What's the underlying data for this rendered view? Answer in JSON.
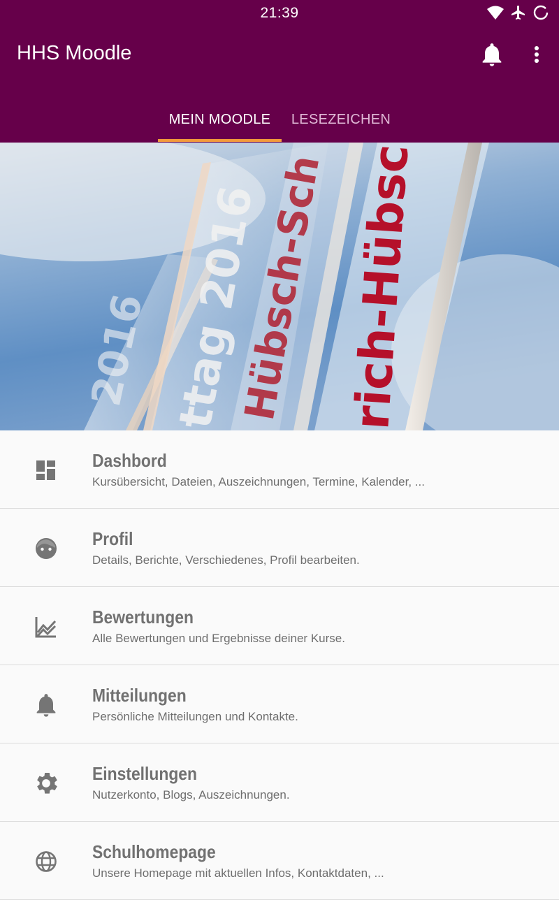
{
  "status_bar": {
    "time": "21:39",
    "icons": [
      "wifi-icon",
      "airplane-mode-icon",
      "battery-charging-icon"
    ]
  },
  "app_bar": {
    "title": "HHS Moodle",
    "actions": [
      "notifications-bell-icon",
      "more-vert-icon"
    ]
  },
  "tabs": [
    {
      "label": "MEIN MOODLE",
      "active": true
    },
    {
      "label": "LESEZEICHEN",
      "active": false
    }
  ],
  "hero": {
    "texts": [
      "2016",
      "ttag 2016",
      "Hübsch-Sch",
      "rich-Hübsc"
    ]
  },
  "menu": [
    {
      "icon": "dashboard-icon",
      "title": "Dashbord",
      "subtitle": "Kursübersicht, Dateien, Auszeichnungen, Termine, Kalender, ..."
    },
    {
      "icon": "profile-face-icon",
      "title": "Profil",
      "subtitle": "Details, Berichte, Verschiedenes, Profil bearbeiten."
    },
    {
      "icon": "chart-icon",
      "title": "Bewertungen",
      "subtitle": "Alle Bewertungen und Ergebnisse deiner Kurse."
    },
    {
      "icon": "bell-icon",
      "title": "Mitteilungen",
      "subtitle": "Persönliche Mitteilungen und Kontakte."
    },
    {
      "icon": "gear-icon",
      "title": "Einstellungen",
      "subtitle": "Nutzerkonto, Blogs, Auszeichnungen."
    },
    {
      "icon": "globe-icon",
      "title": "Schulhomepage",
      "subtitle": "Unsere Homepage mit aktuellen Infos, Kontaktdaten, ..."
    }
  ],
  "colors": {
    "primary": "#66004a",
    "accent": "#f39a3b",
    "icon": "#757575"
  }
}
